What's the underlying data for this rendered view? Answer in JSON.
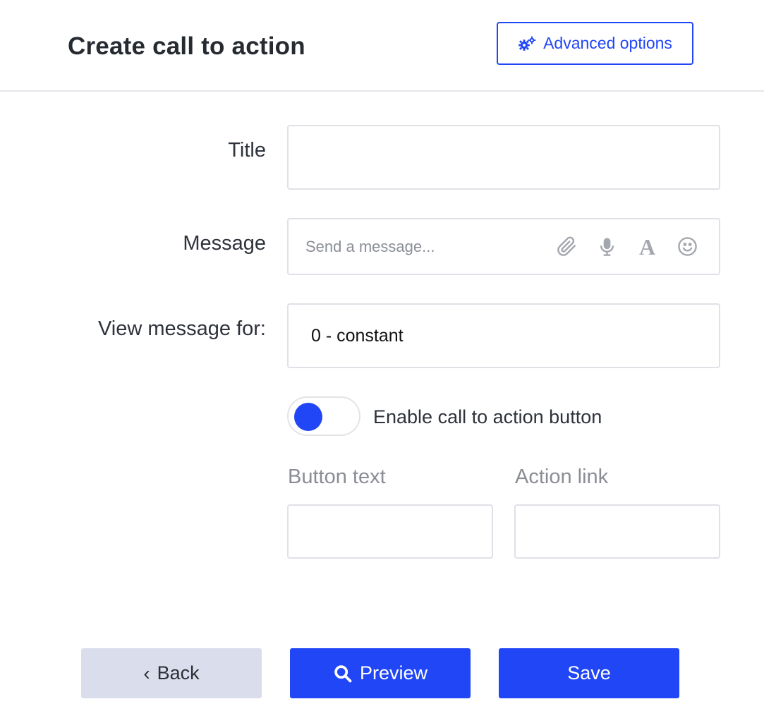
{
  "header": {
    "title": "Create call to action",
    "advanced_options_label": "Advanced options",
    "advanced_options_icon": "gears-icon"
  },
  "form": {
    "title_label": "Title",
    "title_value": "",
    "message_label": "Message",
    "message_placeholder": "Send a message...",
    "message_icons": [
      "paperclip-icon",
      "microphone-icon",
      "font-icon",
      "smiley-icon"
    ],
    "font_icon_glyph": "A",
    "view_label": "View message for:",
    "view_value": "0 - constant",
    "toggle_label": "Enable call to action button",
    "toggle_on": true,
    "button_text_label": "Button text",
    "button_text_value": "",
    "action_link_label": "Action link",
    "action_link_value": ""
  },
  "footer": {
    "back_label": "Back",
    "back_glyph": "‹",
    "preview_label": "Preview",
    "save_label": "Save"
  },
  "colors": {
    "accent": "#2146f5",
    "back_button": "#dadeec",
    "border": "#dfe1e7"
  }
}
